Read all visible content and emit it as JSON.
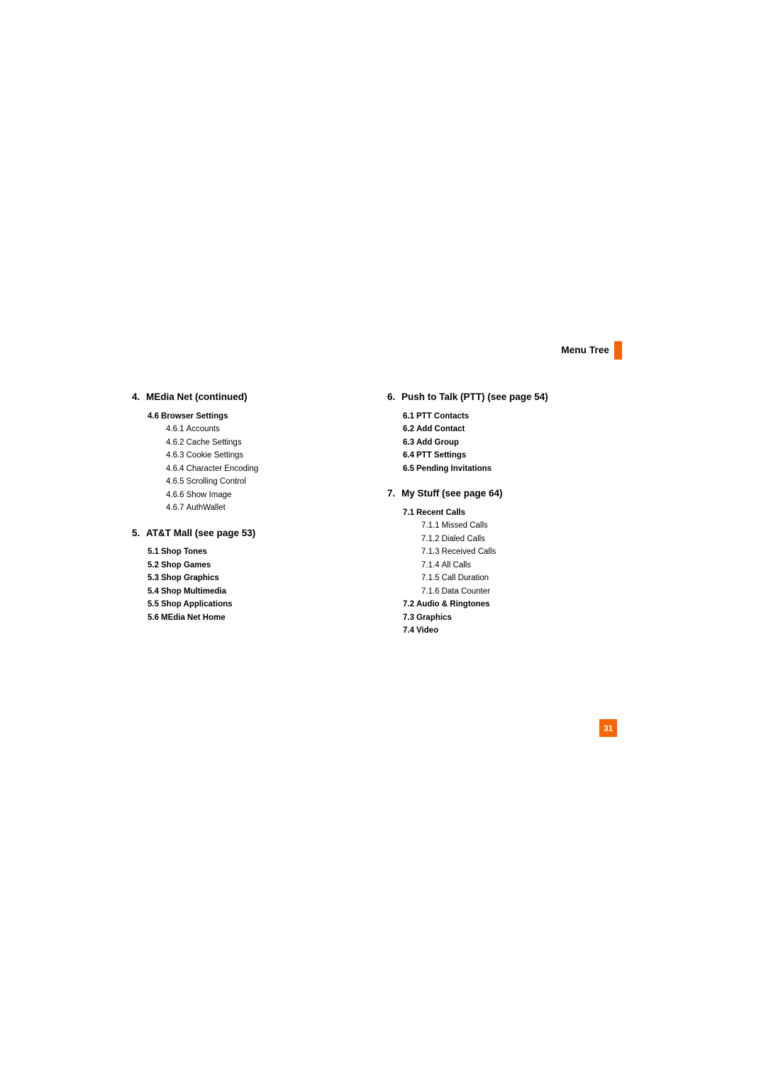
{
  "header": {
    "title": "Menu Tree",
    "marker_color": "#FA6400"
  },
  "page_badge": {
    "number": "31",
    "background": "#FA6400",
    "text_color": "#FFFFFF"
  },
  "columns": {
    "left": [
      {
        "number": "4.",
        "title": "MEdia Net (continued)",
        "children": [
          {
            "number": "4.6",
            "title": "Browser Settings",
            "children": [
              {
                "number": "4.6.1",
                "title": "Accounts"
              },
              {
                "number": "4.6.2",
                "title": "Cache Settings"
              },
              {
                "number": "4.6.3",
                "title": "Cookie Settings"
              },
              {
                "number": "4.6.4",
                "title": "Character Encoding"
              },
              {
                "number": "4.6.5",
                "title": "Scrolling Control"
              },
              {
                "number": "4.6.6",
                "title": "Show Image"
              },
              {
                "number": "4.6.7",
                "title": "AuthWallet"
              }
            ]
          }
        ]
      },
      {
        "number": "5.",
        "title": "AT&T Mall (see page 53)",
        "children": [
          {
            "number": "5.1",
            "title": "Shop Tones"
          },
          {
            "number": "5.2",
            "title": "Shop Games"
          },
          {
            "number": "5.3",
            "title": "Shop Graphics"
          },
          {
            "number": "5.4",
            "title": "Shop Multimedia"
          },
          {
            "number": "5.5",
            "title": "Shop Applications"
          },
          {
            "number": "5.6",
            "title": "MEdia Net Home"
          }
        ]
      }
    ],
    "right": [
      {
        "number": "6.",
        "title": "Push to Talk (PTT) (see page 54)",
        "children": [
          {
            "number": "6.1",
            "title": "PTT Contacts"
          },
          {
            "number": "6.2",
            "title": "Add Contact"
          },
          {
            "number": "6.3",
            "title": "Add Group"
          },
          {
            "number": "6.4",
            "title": "PTT Settings"
          },
          {
            "number": "6.5",
            "title": "Pending Invitations"
          }
        ]
      },
      {
        "number": "7.",
        "title": "My Stuff (see page 64)",
        "children": [
          {
            "number": "7.1",
            "title": "Recent Calls",
            "children": [
              {
                "number": "7.1.1",
                "title": "Missed Calls"
              },
              {
                "number": "7.1.2",
                "title": "Dialed Calls"
              },
              {
                "number": "7.1.3",
                "title": "Received Calls"
              },
              {
                "number": "7.1.4",
                "title": "All Calls"
              },
              {
                "number": "7.1.5",
                "title": "Call Duration"
              },
              {
                "number": "7.1.6",
                "title": "Data Counter"
              }
            ]
          },
          {
            "number": "7.2",
            "title": "Audio & Ringtones"
          },
          {
            "number": "7.3",
            "title": "Graphics"
          },
          {
            "number": "7.4",
            "title": "Video"
          }
        ]
      }
    ]
  }
}
